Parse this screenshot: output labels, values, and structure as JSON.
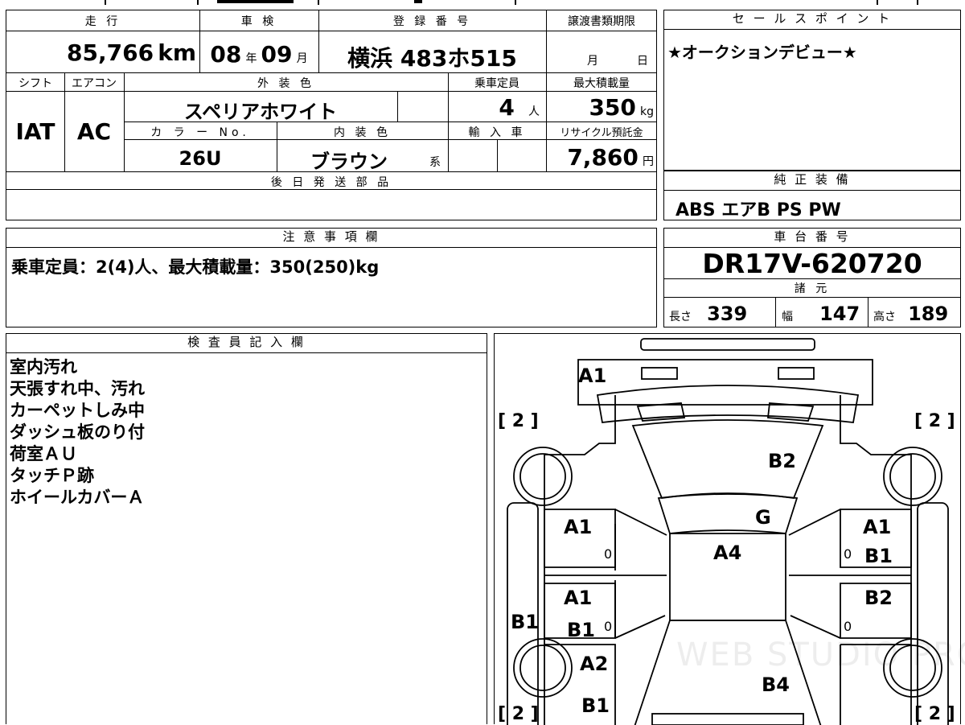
{
  "top_table": {
    "mileage_label": "走 行",
    "mileage_value": "85,766",
    "mileage_unit": "km",
    "shaken_label": "車 検",
    "shaken_year": "08",
    "shaken_year_unit": "年",
    "shaken_month": "09",
    "shaken_month_unit": "月",
    "reg_label": "登 録 番 号",
    "reg_value": "横浜 483ホ515",
    "transfer_label": "譲渡書類期限",
    "transfer_month_unit": "月",
    "transfer_day_unit": "日",
    "shift_label": "シフト",
    "shift_value": "IAT",
    "ac_label": "エアコン",
    "ac_value": "AC",
    "ext_color_label": "外 装 色",
    "ext_color_value": "スペリアホワイト",
    "capacity_label": "乗車定員",
    "capacity_value": "4",
    "capacity_unit": "人",
    "load_label": "最大積載量",
    "load_value": "350",
    "load_unit": "kg",
    "color_no_label": "カ ラ ー No.",
    "color_no_value": "26U",
    "int_color_label": "内 装 色",
    "int_color_value": "ブラウン",
    "int_color_suffix": "系",
    "import_label": "輸 入 車",
    "recycle_label": "リサイクル預託金",
    "recycle_value": "7,860",
    "recycle_unit": "円",
    "later_parts_label": "後 日 発 送 部 品"
  },
  "sales_point": {
    "label": "セ ー ル ス ポ イ ン ト",
    "text": "★オークションデビュー★"
  },
  "genuine_equipment": {
    "label": "純 正 装 備",
    "text": "ABS エアB PS PW"
  },
  "caution": {
    "label": "注 意 事 項 欄",
    "text": "乗車定員：2(4)人、最大積載量：350(250)kg"
  },
  "chassis": {
    "label": "車 台 番 号",
    "value": "DR17V-620720",
    "specs_label": "諸 元",
    "length_label": "長さ",
    "length_value": "339",
    "width_label": "幅",
    "width_value": "147",
    "height_label": "高さ",
    "height_value": "189"
  },
  "inspector": {
    "label": "検 査 員 記 入 欄",
    "notes": [
      "室内汚れ",
      "天張すれ中、汚れ",
      "カーペットしみ中",
      "ダッシュ板のり付",
      "荷室ＡＵ",
      "タッチＰ跡",
      "ホイールカバーＡ"
    ]
  },
  "diagram": {
    "tire_marks": [
      "[ 2 ]",
      "[ 2 ]",
      "[ 2 ]",
      "[ 2 ]"
    ],
    "labels": {
      "front_bumper": "A1",
      "hood": "B2",
      "windshield": "G",
      "roof": "A4",
      "rear": "B4",
      "left_front_door": "A1",
      "left_rear_door_a": "A1",
      "left_rear_door_b": "B1",
      "left_rocker": "B1",
      "left_quarter_a": "A2",
      "left_quarter_b": "B1",
      "right_front_door_a": "A1",
      "right_front_door_b": "B1",
      "right_rear_door": "B2",
      "zero": "0"
    },
    "watermark": "WEB STUDIO PRO"
  }
}
